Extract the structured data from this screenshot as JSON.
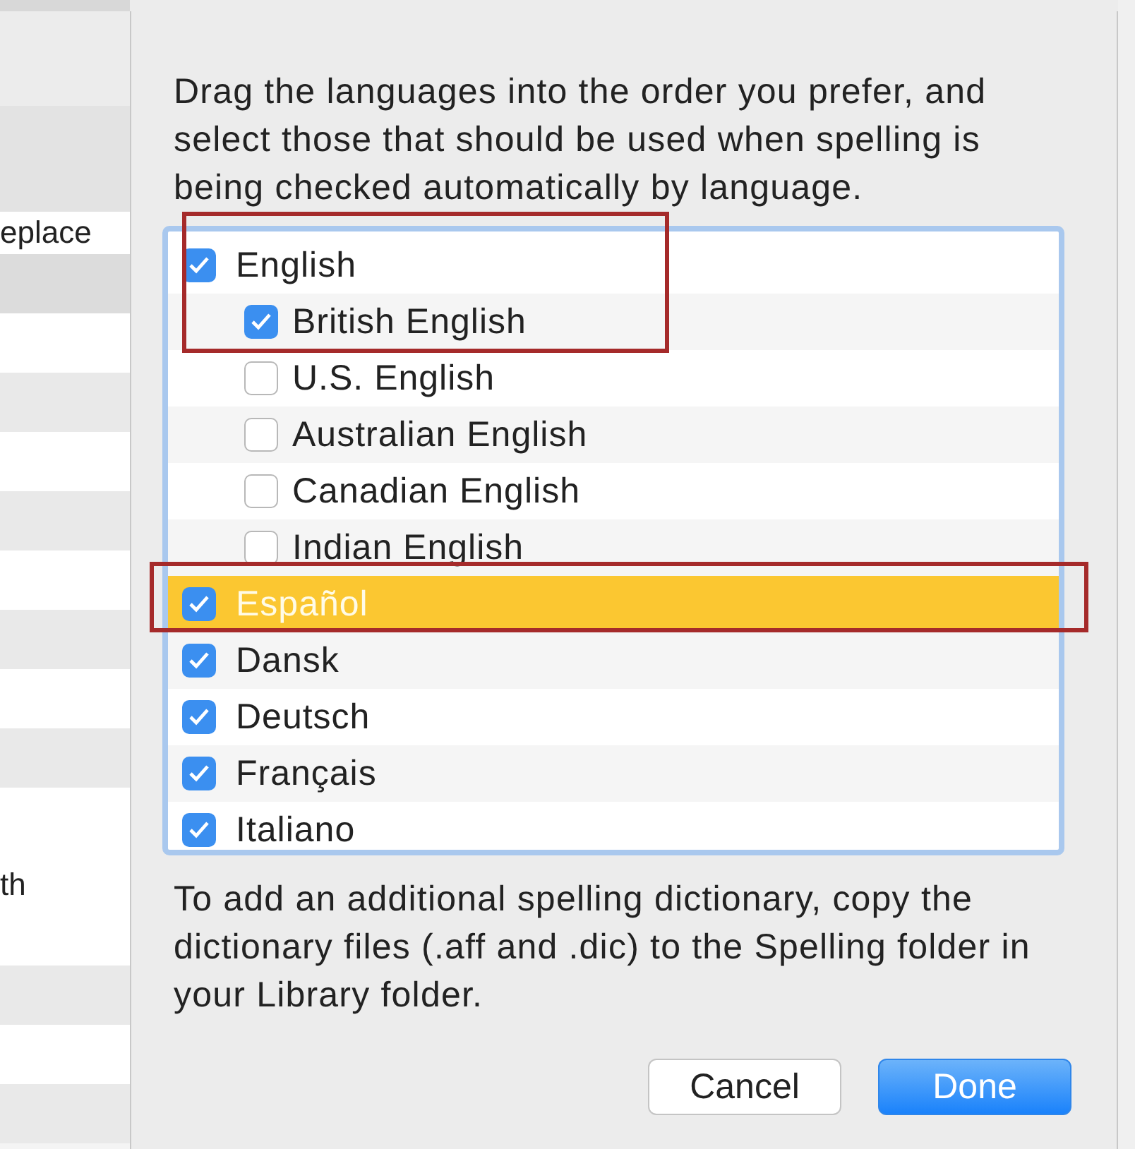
{
  "background_table": {
    "header_cell": "eplace",
    "cell": "th"
  },
  "sheet": {
    "intro": "Drag the languages into the order you prefer, and select those that should be used when spelling is being checked automatically by language.",
    "languages": [
      {
        "label": "English",
        "checked": true,
        "selected": false,
        "children": [
          {
            "label": "British English",
            "checked": true,
            "selected": false
          },
          {
            "label": "U.S. English",
            "checked": false,
            "selected": false
          },
          {
            "label": "Australian English",
            "checked": false,
            "selected": false
          },
          {
            "label": "Canadian English",
            "checked": false,
            "selected": false
          },
          {
            "label": "Indian English",
            "checked": false,
            "selected": false
          }
        ]
      },
      {
        "label": "Español",
        "checked": true,
        "selected": true
      },
      {
        "label": "Dansk",
        "checked": true,
        "selected": false
      },
      {
        "label": "Deutsch",
        "checked": true,
        "selected": false
      },
      {
        "label": "Français",
        "checked": true,
        "selected": false
      },
      {
        "label": "Italiano",
        "checked": true,
        "selected": false
      }
    ],
    "note": "To add an additional spelling dictionary, copy the dictionary files (.aff and .dic) to the Spelling folder in your Library folder.",
    "buttons": [
      {
        "label": "Cancel",
        "kind": "secondary"
      },
      {
        "label": "Done",
        "kind": "primary"
      }
    ]
  }
}
